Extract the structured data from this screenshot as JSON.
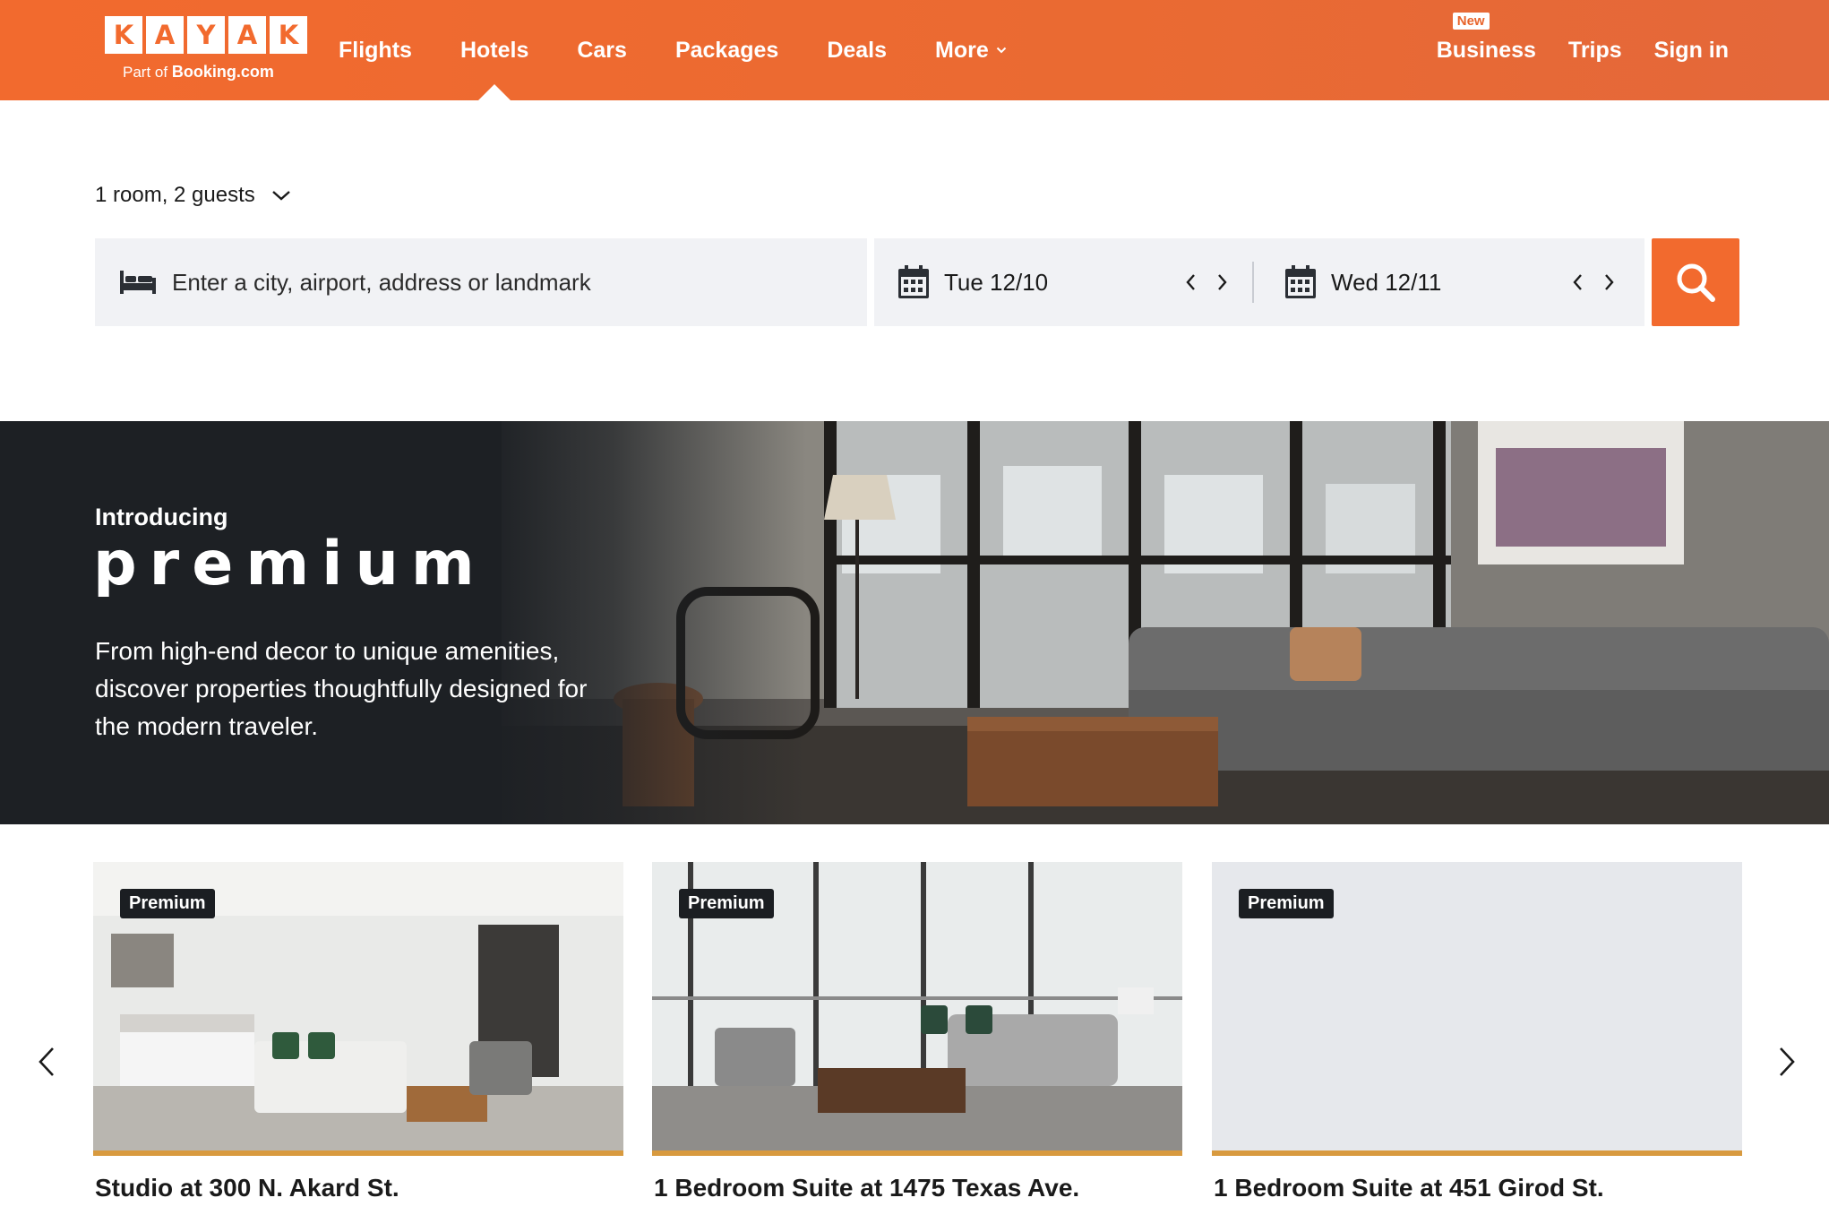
{
  "brand": {
    "letters": [
      "K",
      "A",
      "Y",
      "A",
      "K"
    ],
    "sub_prefix": "Part of",
    "sub_brand": "Booking.com",
    "accent_color": "#f26a2e"
  },
  "nav": {
    "items": [
      {
        "label": "Flights"
      },
      {
        "label": "Hotels",
        "active": true
      },
      {
        "label": "Cars"
      },
      {
        "label": "Packages"
      },
      {
        "label": "Deals"
      },
      {
        "label": "More"
      }
    ],
    "right": {
      "new_badge": "New",
      "business": "Business",
      "trips": "Trips",
      "sign_in": "Sign in"
    }
  },
  "search": {
    "guests": "1 room, 2 guests",
    "destination_placeholder": "Enter a city, airport, address or landmark",
    "check_in": "Tue 12/10",
    "check_out": "Wed 12/11"
  },
  "hero": {
    "intro": "Introducing",
    "title": "premium",
    "description": "From high-end decor to unique amenities, discover properties thoughtfully designed for the modern traveler."
  },
  "cards": [
    {
      "badge": "Premium",
      "title": "Studio at 300 N. Akard St."
    },
    {
      "badge": "Premium",
      "title": "1 Bedroom Suite at 1475 Texas Ave."
    },
    {
      "badge": "Premium",
      "title": "1 Bedroom Suite at 451 Girod St."
    }
  ],
  "icons": {
    "bed": "bed-icon",
    "calendar": "calendar-icon",
    "search": "search-icon",
    "chevron_down": "chevron-down-icon",
    "chevron_left": "chevron-left-icon",
    "chevron_right": "chevron-right-icon"
  }
}
